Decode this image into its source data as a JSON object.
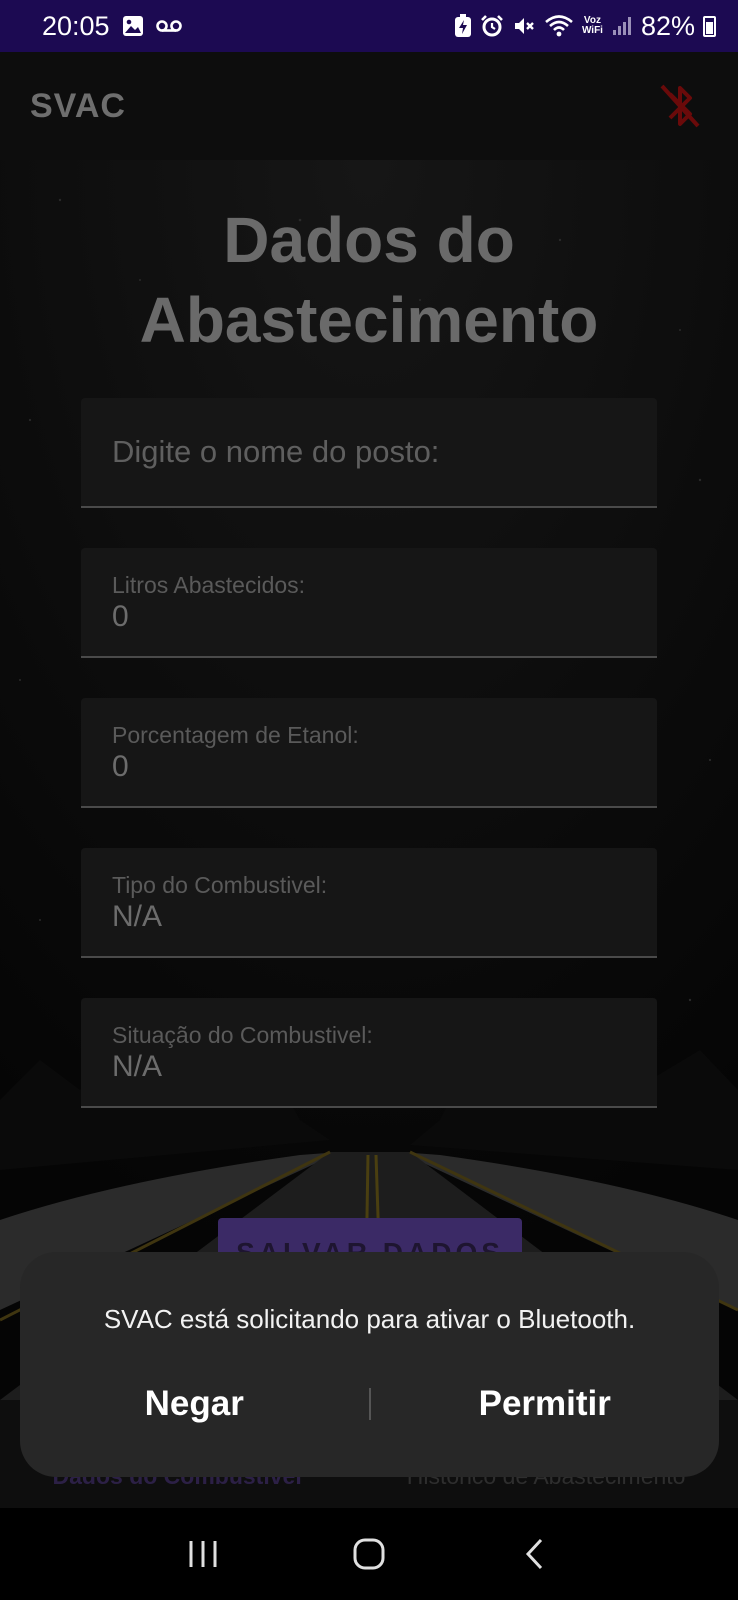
{
  "status_bar": {
    "time": "20:05",
    "battery": "82%",
    "voz_top": "Voz",
    "voz_bottom": "WiFi",
    "left_icons": [
      "image-icon",
      "voicemail-icon"
    ],
    "right_icons": [
      "battery-saver-icon",
      "alarm-icon",
      "mute-icon",
      "wifi-icon",
      "voz-wifi-icon",
      "signal-icon",
      "battery-icon"
    ]
  },
  "app_bar": {
    "title": "SVAC",
    "bluetooth_icon": "bluetooth-disabled-icon",
    "bluetooth_color": "#b00000"
  },
  "main": {
    "heading_line1": "Dados do",
    "heading_line2": "Abastecimento",
    "station_placeholder": "Digite o nome do posto:",
    "fields": [
      {
        "label": "Litros Abastecidos:",
        "value": "0"
      },
      {
        "label": "Porcentagem de Etanol:",
        "value": "0"
      },
      {
        "label": "Tipo do Combustivel:",
        "value": "N/A"
      },
      {
        "label": "Situação do Combustivel:",
        "value": "N/A"
      }
    ],
    "save_button": "SALVAR DADOS"
  },
  "bottom_nav": {
    "tabs": [
      {
        "label": "Dados do Combustível",
        "active": true
      },
      {
        "label": "Histórico de Abastecimento",
        "active": false
      }
    ]
  },
  "dialog": {
    "message": "SVAC está solicitando para ativar o Bluetooth.",
    "deny_label": "Negar",
    "allow_label": "Permitir"
  },
  "system_nav": {
    "icons": [
      "recent-apps-icon",
      "home-icon",
      "back-icon"
    ]
  },
  "colors": {
    "status_bar_bg": "#1c0a52",
    "accent": "#3b2a66",
    "dialog_bg": "#272727"
  }
}
